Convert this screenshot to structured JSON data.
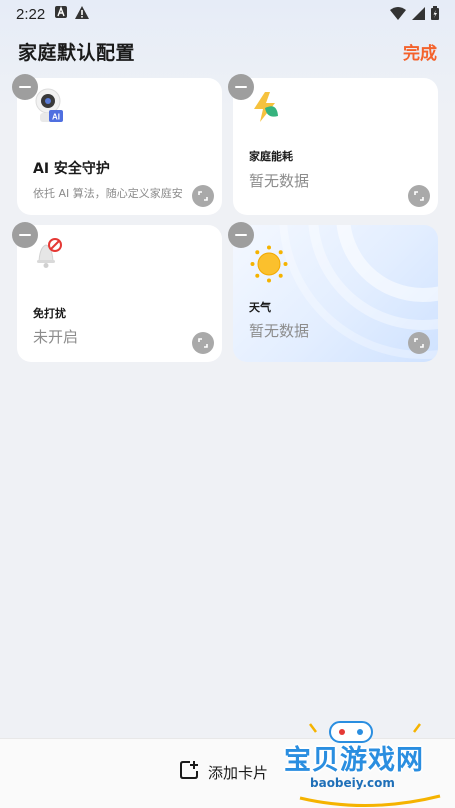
{
  "status_bar": {
    "time": "2:22"
  },
  "header": {
    "title": "家庭默认配置",
    "done_label": "完成"
  },
  "cards": {
    "security": {
      "title": "AI 安全守护",
      "subtitle": "依托 AI 算法，随心定义家庭安"
    },
    "energy": {
      "title": "家庭能耗",
      "value": "暂无数据"
    },
    "dnd": {
      "title": "免打扰",
      "value": "未开启"
    },
    "weather": {
      "title": "天气",
      "value": "暂无数据"
    }
  },
  "bottom": {
    "add_card_label": "添加卡片"
  },
  "watermark": {
    "brand": "宝贝游戏网",
    "url": "baobeiy.com"
  },
  "colors": {
    "accent": "#f4622c",
    "card_bg": "#ffffff",
    "page_bg": "#eff1f5"
  }
}
